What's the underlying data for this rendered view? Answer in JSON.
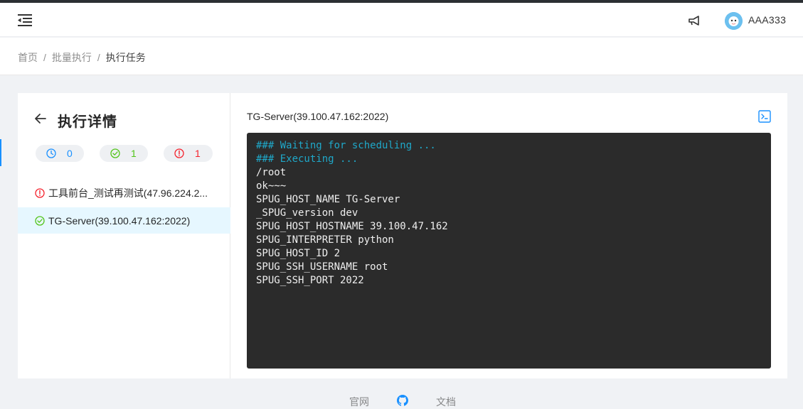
{
  "header": {
    "username": "AAA333"
  },
  "breadcrumb": {
    "home": "首页",
    "batch": "批量执行",
    "current": "执行任务"
  },
  "sidebar": {
    "title": "执行详情",
    "stats": {
      "waiting": "0",
      "success": "1",
      "failed": "1"
    },
    "hosts": [
      {
        "label": "工具前台_测试再测试(47.96.224.2...",
        "status": "failed"
      },
      {
        "label": "TG-Server(39.100.47.162:2022)",
        "status": "success"
      }
    ]
  },
  "main": {
    "title": "TG-Server(39.100.47.162:2022)",
    "console_lines": [
      {
        "text": "### Waiting for scheduling ...",
        "kind": "info"
      },
      {
        "text": "### Executing ...",
        "kind": "info"
      },
      {
        "text": "/root",
        "kind": "out"
      },
      {
        "text": "ok~~~",
        "kind": "out"
      },
      {
        "text": "SPUG_HOST_NAME TG-Server",
        "kind": "out"
      },
      {
        "text": "_SPUG_version dev",
        "kind": "out"
      },
      {
        "text": "SPUG_HOST_HOSTNAME 39.100.47.162",
        "kind": "out"
      },
      {
        "text": "SPUG_INTERPRETER python",
        "kind": "out"
      },
      {
        "text": "SPUG_HOST_ID 2",
        "kind": "out"
      },
      {
        "text": "SPUG_SSH_USERNAME root",
        "kind": "out"
      },
      {
        "text": "SPUG_SSH_PORT 2022",
        "kind": "out"
      }
    ]
  },
  "footer": {
    "site": "官网",
    "docs": "文档"
  },
  "colors": {
    "primary": "#1890ff",
    "success": "#52c41a",
    "error": "#f5222d",
    "console_bg": "#2b2b2b",
    "console_info": "#1fa8c9"
  }
}
